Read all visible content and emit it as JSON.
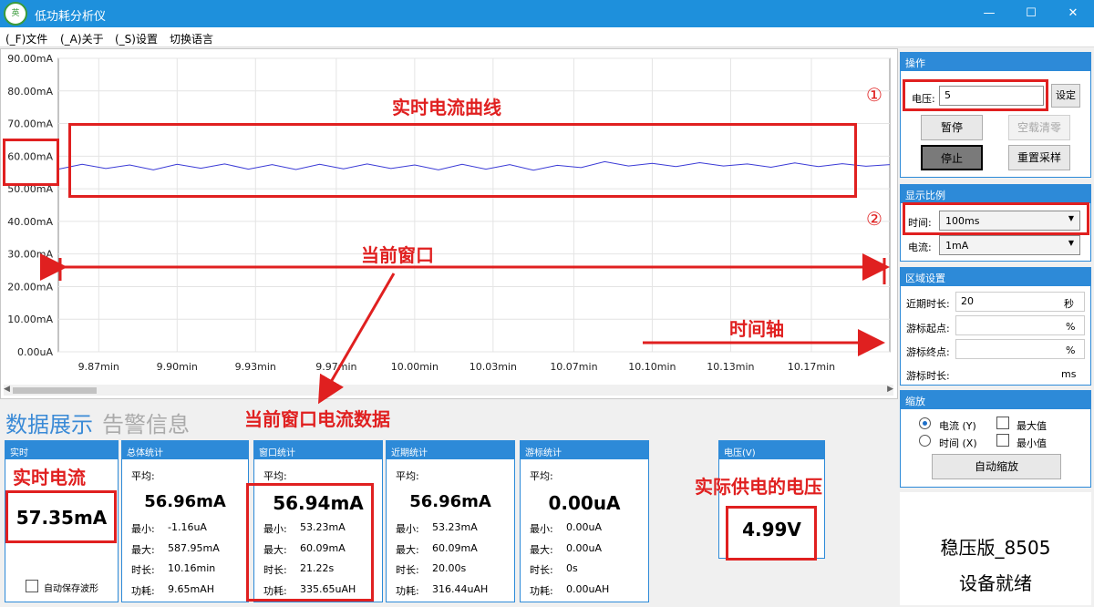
{
  "window": {
    "title": "低功耗分析仪",
    "logo_text": "英",
    "minimize": "—",
    "maximize": "☐",
    "close": "✕"
  },
  "menu": [
    "(_F)文件",
    "(_A)关于",
    "(_S)设置",
    "切换语言"
  ],
  "chart_data": {
    "type": "line",
    "y_ticks": [
      "90.00mA",
      "80.00mA",
      "70.00mA",
      "60.00mA",
      "50.00mA",
      "40.00mA",
      "30.00mA",
      "20.00mA",
      "10.00mA",
      "0.00uA"
    ],
    "ylim": [
      0,
      90
    ],
    "x_ticks": [
      "9.87min",
      "9.90min",
      "9.93min",
      "9.97min",
      "10.00min",
      "10.03min",
      "10.07min",
      "10.10min",
      "10.13min",
      "10.17min"
    ],
    "xlim": [
      9.85,
      10.2
    ],
    "series": [
      {
        "color": "#3b3bd6",
        "x": [
          9.85,
          9.86,
          9.87,
          9.88,
          9.89,
          9.9,
          9.91,
          9.92,
          9.93,
          9.94,
          9.95,
          9.96,
          9.97,
          9.98,
          9.99,
          10.0,
          10.01,
          10.02,
          10.03,
          10.04,
          10.05,
          10.06,
          10.07,
          10.08,
          10.09,
          10.1,
          10.11,
          10.12,
          10.13,
          10.14,
          10.15,
          10.16,
          10.17,
          10.18,
          10.19,
          10.2
        ],
        "values": [
          56,
          57.5,
          56.2,
          57.3,
          55.8,
          57.5,
          56.3,
          57.6,
          56,
          57.4,
          55.9,
          57.5,
          56.1,
          57.6,
          56.2,
          57.3,
          55.8,
          57.5,
          56,
          57.4,
          55.7,
          57.2,
          56.5,
          58.3,
          57,
          57.8,
          56.8,
          58,
          57,
          57.6,
          56.6,
          57.9,
          56.8,
          57.7,
          56.9,
          57.4
        ]
      }
    ],
    "grid": true
  },
  "tabs": {
    "data": "数据展示",
    "alarm": "告警信息"
  },
  "realtime": {
    "title": "实时",
    "value": "57.35mA",
    "autosave": "自动保存波形"
  },
  "panels": [
    {
      "title": "总体统计",
      "avg_label": "平均:",
      "avg": "56.96mA",
      "rows": [
        [
          "最小:",
          "-1.16uA"
        ],
        [
          "最大:",
          "587.95mA"
        ],
        [
          "时长:",
          "10.16min"
        ],
        [
          "功耗:",
          "9.65mAH"
        ]
      ]
    },
    {
      "title": "窗口统计",
      "avg_label": "平均:",
      "avg": "56.94mA",
      "rows": [
        [
          "最小:",
          "53.23mA"
        ],
        [
          "最大:",
          "60.09mA"
        ],
        [
          "时长:",
          "21.22s"
        ],
        [
          "功耗:",
          "335.65uAH"
        ]
      ]
    },
    {
      "title": "近期统计",
      "avg_label": "平均:",
      "avg": "56.96mA",
      "rows": [
        [
          "最小:",
          "53.23mA"
        ],
        [
          "最大:",
          "60.09mA"
        ],
        [
          "时长:",
          "20.00s"
        ],
        [
          "功耗:",
          "316.44uAH"
        ]
      ]
    },
    {
      "title": "游标统计",
      "avg_label": "平均:",
      "avg": "0.00uA",
      "rows": [
        [
          "最小:",
          "0.00uA"
        ],
        [
          "最大:",
          "0.00uA"
        ],
        [
          "时长:",
          "0s"
        ],
        [
          "功耗:",
          "0.00uAH"
        ]
      ]
    }
  ],
  "voltage": {
    "title": "电压(V)",
    "value": "4.99V"
  },
  "ops": {
    "title": "操作",
    "voltage_label": "电压:",
    "voltage_value": "5",
    "set": "设定",
    "pause": "暂停",
    "clear": "空载清零",
    "stop": "停止",
    "reset": "重置采样"
  },
  "scale": {
    "title": "显示比例",
    "time_label": "时间:",
    "time_value": "100ms",
    "current_label": "电流:",
    "current_value": "1mA"
  },
  "region": {
    "title": "区域设置",
    "recent_label": "近期时长:",
    "recent_value": "20",
    "recent_unit": "秒",
    "start_label": "游标起点:",
    "start_unit": "%",
    "end_label": "游标终点:",
    "end_unit": "%",
    "cursor_label": "游标时长:",
    "cursor_unit": "ms"
  },
  "zoom": {
    "title": "缩放",
    "current": "电流 (Y)",
    "time": "时间 (X)",
    "max": "最大值",
    "min": "最小值",
    "auto": "自动缩放"
  },
  "status": {
    "model": "稳压版_8505",
    "state": "设备就绪"
  },
  "annotations": {
    "curve": "实时电流曲线",
    "window": "当前窗口",
    "axis": "时间轴",
    "window_data": "当前窗口电流数据",
    "realtime": "实时电流",
    "voltage": "实际供电的电压",
    "mark1": "①",
    "mark2": "②"
  },
  "colors": {
    "accent": "#2d8ad8",
    "titlebar": "#1e90dc",
    "annotation": "#e02020",
    "series": "#3b3bd6"
  }
}
